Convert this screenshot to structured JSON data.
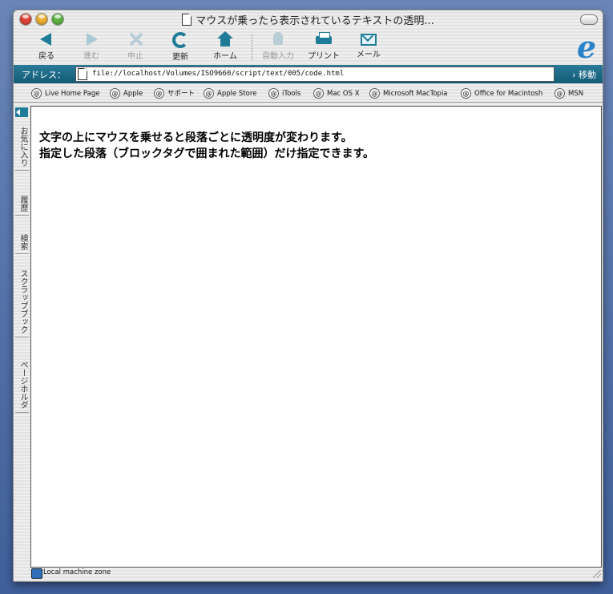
{
  "window": {
    "title": "マウスが乗ったら表示されているテキストの透明..."
  },
  "toolbar": {
    "back_label": "戻る",
    "forward_label": "進む",
    "stop_label": "中止",
    "refresh_label": "更新",
    "home_label": "ホーム",
    "autofill_label": "自動入力",
    "print_label": "プリント",
    "mail_label": "メール",
    "logo_letter": "e"
  },
  "address": {
    "label": "アドレス：",
    "url": "file://localhost/Volumes/ISO9660/script/text/005/code.html",
    "go_label": "› 移動"
  },
  "favorites": [
    {
      "label": "Live Home Page"
    },
    {
      "label": "Apple"
    },
    {
      "label": "サポート"
    },
    {
      "label": "Apple Store"
    },
    {
      "label": "iTools"
    },
    {
      "label": "Mac OS X"
    },
    {
      "label": "Microsoft MacTopia"
    },
    {
      "label": "Office for Macintosh"
    },
    {
      "label": "MSN"
    }
  ],
  "sidebar_tabs": [
    {
      "label": "お気に入り"
    },
    {
      "label": "履歴"
    },
    {
      "label": "検索"
    },
    {
      "label": "スクラップブック"
    },
    {
      "label": "ページホルダ"
    }
  ],
  "content": {
    "paragraphs": [
      "文字の上にマウスを乗せると段落ごとに透明度が変わります。",
      "指定した段落（ブロックタグで囲まれた範囲）だけ指定できます。"
    ]
  },
  "status": {
    "zone": "Local machine zone"
  },
  "colors": {
    "accent": "#1f7c98",
    "address_bar": "#135b75"
  }
}
